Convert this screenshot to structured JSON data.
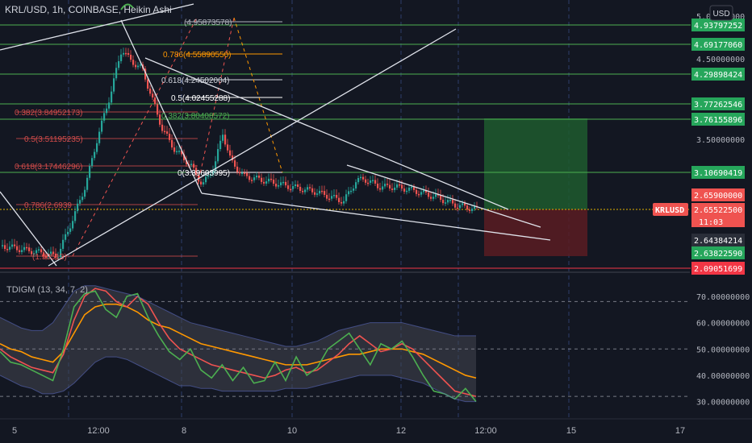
{
  "header": {
    "symbol_line": "KRL/USD, 1h, COINBASE, Heikin Ashi",
    "currency_button": "USD"
  },
  "indicator": {
    "label": "TDIGM (13, 34, 7, 2)"
  },
  "colors": {
    "background": "#131722",
    "up": "#26a69a",
    "down": "#ef5350",
    "hline": "#4caf50",
    "fib_orange": "#ff9800",
    "profit_zone": "#1e5a2e",
    "loss_zone": "#5a1c22",
    "band": "#2a2e39"
  },
  "chart_data": [
    {
      "type": "candlestick",
      "style": "heikin-ashi",
      "y_ticks": [
        "5.00000000",
        "4.50000000",
        "3.50000000"
      ],
      "x_ticks": [
        "5",
        "12:00",
        "8",
        "10",
        "12",
        "12:00",
        "15",
        "17"
      ],
      "horizontal_levels": [
        {
          "value": 4.93797252,
          "label": "4.93797252",
          "color": "#4caf50"
        },
        {
          "value": 4.6917706,
          "label": "4.69177060",
          "color": "#4caf50"
        },
        {
          "value": 4.29898424,
          "label": "4.29898424",
          "color": "#4caf50"
        },
        {
          "value": 3.77262546,
          "label": "3.77262546",
          "color": "#4caf50"
        },
        {
          "value": 3.76155896,
          "label": "3.76155896",
          "color": "#4caf50"
        },
        {
          "value": 3.10690419,
          "label": "3.10690419",
          "color": "#4caf50"
        },
        {
          "value": 2.659,
          "label": "2.65900000",
          "color": "#ef5350"
        },
        {
          "value": 2.655225,
          "label": "2.65522500",
          "color": "#ef5350"
        },
        {
          "value": 2.64384214,
          "label": "2.64384214",
          "color": "#2a2e39"
        },
        {
          "value": 2.6382259,
          "label": "2.63822590",
          "color": "#4caf50"
        },
        {
          "value": 2.09051699,
          "label": "2.09051699",
          "color": "#f23645"
        }
      ],
      "current_price": {
        "symbol": "KRLUSD",
        "value": "2.65522500",
        "countdown": "11:03"
      },
      "fib_right": [
        {
          "label": "(4.95873578)",
          "color": "#b2b5be"
        },
        {
          "label": "0.786(4.55890550)",
          "color": "#ff9800"
        },
        {
          "label": "0.618(4.24502004)",
          "color": "#d1d4dc"
        },
        {
          "label": "0.5(4.02455288)",
          "color": "#ffffff"
        },
        {
          "label": "0.382(3.80408572)",
          "color": "#4caf50"
        },
        {
          "label": "0(3.39603995)",
          "color": "#ffffff"
        }
      ],
      "fib_left": [
        {
          "label": "0.382(3.84952173)",
          "color": "#ef5350"
        },
        {
          "label": "0.5(3.51195235)",
          "color": "#ef5350"
        },
        {
          "label": "0.618(3.17446296)",
          "color": "#ef5350"
        },
        {
          "label": "0.786(2.6939",
          "color": "#ef5350"
        },
        {
          "label": "(1.98513)",
          "color": "#ef5350"
        }
      ]
    },
    {
      "type": "line",
      "title": "TDIGM (13, 34, 7, 2)",
      "y_ticks": [
        "70.00000000",
        "60.00000000",
        "50.00000000",
        "40.00000000",
        "30.00000000"
      ],
      "ylim": [
        25,
        77
      ],
      "series": [
        {
          "color": "#ff9800",
          "values": [
            52,
            50,
            49,
            47,
            46,
            45,
            49,
            56,
            63,
            66,
            67,
            67,
            66,
            64,
            61,
            59,
            58,
            56,
            54,
            52,
            51,
            50,
            49,
            48,
            47,
            46,
            45,
            44,
            44,
            44,
            45,
            46,
            47,
            48,
            48,
            49,
            50,
            50,
            50,
            49,
            48,
            46,
            44,
            42,
            40,
            39
          ]
        },
        {
          "color": "#ef5350",
          "values": [
            50,
            47,
            45,
            43,
            42,
            41,
            48,
            61,
            70,
            73,
            72,
            68,
            66,
            70,
            67,
            60,
            54,
            50,
            48,
            46,
            44,
            43,
            42,
            41,
            40,
            39,
            40,
            42,
            43,
            41,
            42,
            45,
            48,
            52,
            55,
            52,
            49,
            50,
            52,
            50,
            46,
            42,
            38,
            34,
            33,
            32
          ]
        },
        {
          "color": "#4caf50",
          "values": [
            49,
            45,
            44,
            42,
            40,
            38,
            50,
            66,
            71,
            72,
            65,
            62,
            70,
            71,
            62,
            55,
            49,
            46,
            50,
            42,
            39,
            44,
            38,
            43,
            37,
            38,
            45,
            38,
            47,
            40,
            43,
            50,
            53,
            56,
            50,
            44,
            52,
            50,
            53,
            47,
            40,
            34,
            33,
            31,
            35,
            30
          ]
        },
        {
          "color": "#5c6bc0",
          "values": [
            62,
            60,
            58,
            57,
            57,
            60,
            66,
            72,
            74,
            74,
            73,
            72,
            71,
            70,
            68,
            66,
            64,
            62,
            60,
            59,
            58,
            57,
            56,
            55,
            54,
            53,
            52,
            51,
            51,
            52,
            53,
            55,
            57,
            58,
            59,
            60,
            60,
            60,
            60,
            59,
            58,
            57,
            56,
            55,
            55,
            55
          ]
        },
        {
          "color": "#5c6bc0",
          "values": [
            40,
            38,
            36,
            35,
            33,
            33,
            34,
            37,
            41,
            45,
            47,
            47,
            46,
            44,
            42,
            40,
            38,
            36,
            36,
            35,
            35,
            34,
            34,
            34,
            34,
            34,
            34,
            35,
            35,
            35,
            36,
            37,
            38,
            39,
            40,
            40,
            40,
            40,
            39,
            38,
            37,
            35,
            33,
            31,
            30,
            30
          ]
        }
      ]
    }
  ]
}
